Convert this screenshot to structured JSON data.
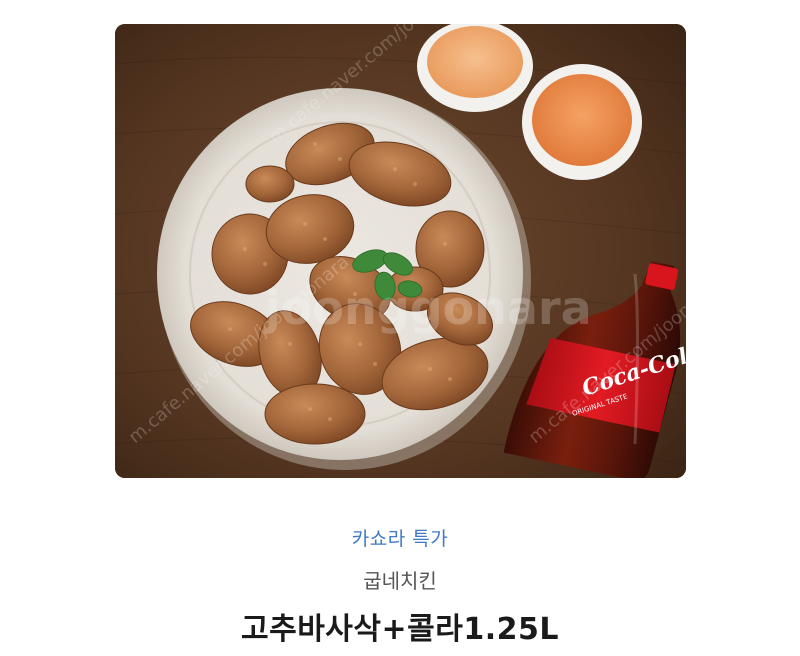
{
  "product": {
    "event_label": "카쇼라 특가",
    "brand": "굽네치킨",
    "name": "고추바사삭+콜라1.25L"
  },
  "image": {
    "watermark_brand": "joonggonara",
    "watermark_url": "m.cafe.naver.com/joonggonara",
    "bottle_logo": "Coca-Cola",
    "bottle_sublabel": "ORIGINAL TASTE",
    "icon": "fried-chicken-with-cola-photo"
  },
  "colors": {
    "event_label": "#3f7bc4",
    "brand": "#555555",
    "product_name": "#1a1a1a",
    "table_wood": "#5a3a24",
    "sauce": "#f0a066",
    "cola_red": "#d8141c"
  }
}
